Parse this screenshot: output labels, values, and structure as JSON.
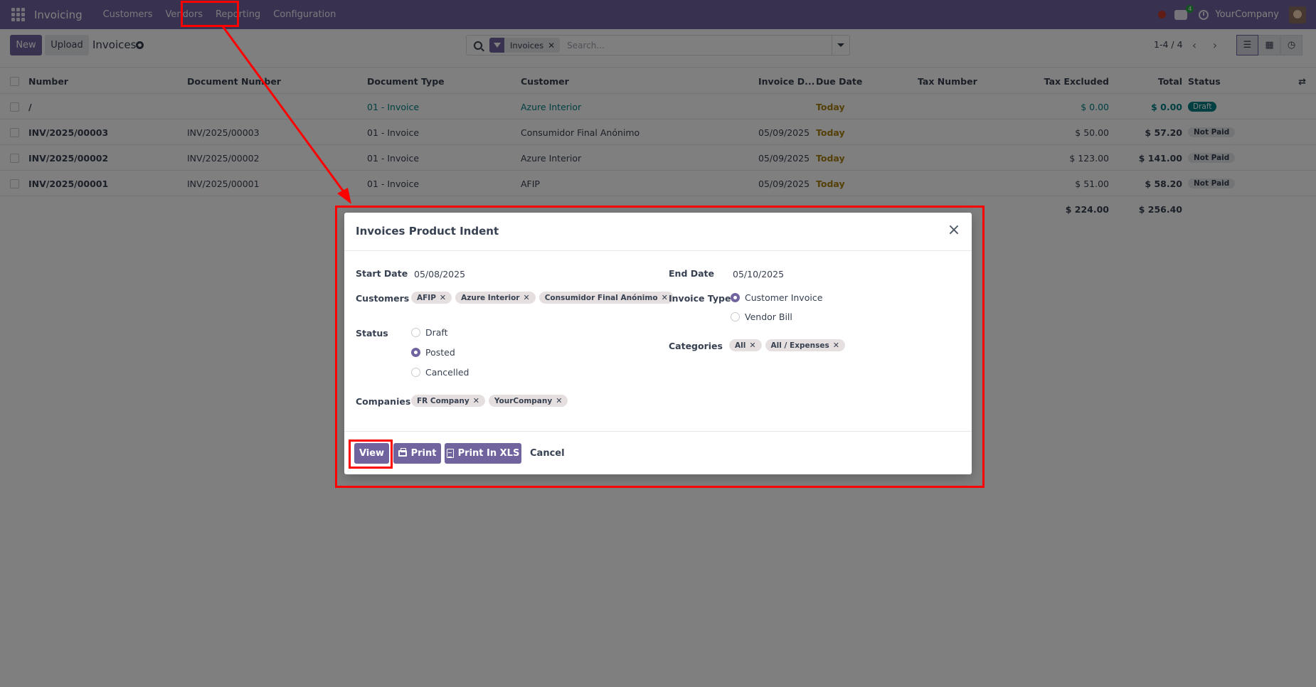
{
  "navbar": {
    "brand": "Invoicing",
    "menu": [
      "Customers",
      "Vendors",
      "Reporting",
      "Configuration"
    ],
    "chat_count": "4",
    "company": "YourCompany"
  },
  "control": {
    "new_label": "New",
    "upload_label": "Upload",
    "title": "Invoices",
    "facet": "Invoices",
    "search_placeholder": "Search...",
    "pager": "1-4 / 4"
  },
  "table": {
    "headers": {
      "number": "Number",
      "document_number": "Document Number",
      "document_type": "Document Type",
      "customer": "Customer",
      "invoice_date": "Invoice D...",
      "due_date": "Due Date",
      "tax_number": "Tax Number",
      "tax_excluded": "Tax Excluded",
      "total": "Total",
      "status": "Status"
    },
    "rows": [
      {
        "number": "/",
        "document_number": "",
        "document_type": "01 - Invoice",
        "customer": "Azure Interior",
        "invoice_date": "",
        "due_date": "Today",
        "tax_excluded": "$ 0.00",
        "total": "$ 0.00",
        "status": "Draft"
      },
      {
        "number": "INV/2025/00003",
        "document_number": "INV/2025/00003",
        "document_type": "01 - Invoice",
        "customer": "Consumidor Final Anónimo",
        "invoice_date": "05/09/2025",
        "due_date": "Today",
        "tax_excluded": "$ 50.00",
        "total": "$ 57.20",
        "status": "Not Paid"
      },
      {
        "number": "INV/2025/00002",
        "document_number": "INV/2025/00002",
        "document_type": "01 - Invoice",
        "customer": "Azure Interior",
        "invoice_date": "05/09/2025",
        "due_date": "Today",
        "tax_excluded": "$ 123.00",
        "total": "$ 141.00",
        "status": "Not Paid"
      },
      {
        "number": "INV/2025/00001",
        "document_number": "INV/2025/00001",
        "document_type": "01 - Invoice",
        "customer": "AFIP",
        "invoice_date": "05/09/2025",
        "due_date": "Today",
        "tax_excluded": "$ 51.00",
        "total": "$ 58.20",
        "status": "Not Paid"
      }
    ],
    "totals": {
      "tax_excluded": "$ 224.00",
      "total": "$ 256.40"
    }
  },
  "modal": {
    "title": "Invoices Product Indent",
    "start_date_label": "Start Date",
    "start_date": "05/08/2025",
    "end_date_label": "End Date",
    "end_date": "05/10/2025",
    "customers_label": "Customers",
    "customers": [
      "AFIP",
      "Azure Interior",
      "Consumidor Final Anónimo"
    ],
    "invoice_type_label": "Invoice Type",
    "invoice_types": [
      "Customer Invoice",
      "Vendor Bill"
    ],
    "invoice_type_selected": "Customer Invoice",
    "status_label": "Status",
    "statuses": [
      "Draft",
      "Posted",
      "Cancelled"
    ],
    "status_selected": "Posted",
    "categories_label": "Categories",
    "categories": [
      "All",
      "All / Expenses"
    ],
    "companies_label": "Companies",
    "companies": [
      "FR Company",
      "YourCompany"
    ],
    "buttons": {
      "view": "View",
      "print": "Print",
      "print_xls": "Print In XLS",
      "cancel": "Cancel"
    }
  },
  "colors": {
    "brand": "#71639e",
    "link": "#017e84",
    "today": "#a8800f",
    "annotation": "#ff0000"
  }
}
